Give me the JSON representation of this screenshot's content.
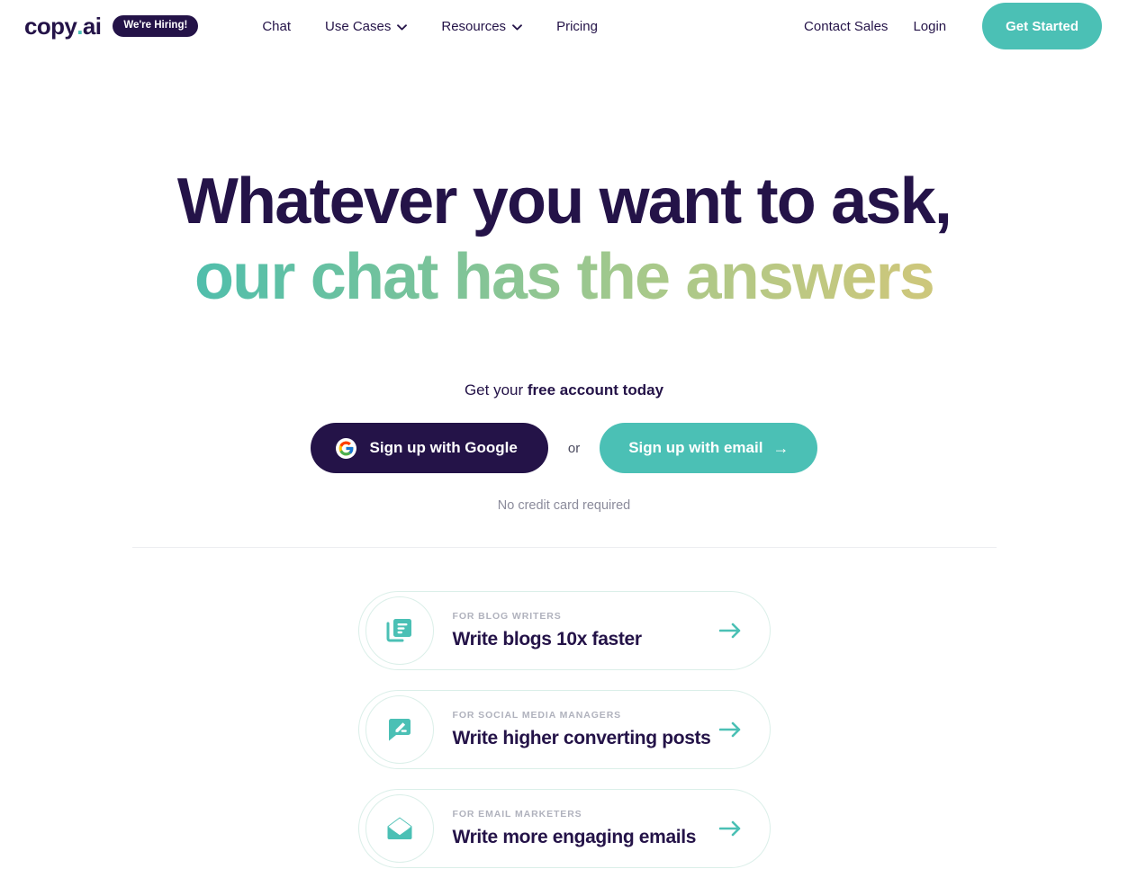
{
  "brand": {
    "logo_text_1": "copy",
    "logo_dot": ".",
    "logo_text_2": "ai",
    "hiring_badge": "We're Hiring!",
    "accent_teal": "#4BC0B5",
    "dark_navy": "#241348",
    "gradient_start": "#3FBDB6",
    "gradient_end": "#D7C774"
  },
  "nav": {
    "items": [
      {
        "label": "Chat",
        "has_dropdown": false
      },
      {
        "label": "Use Cases",
        "has_dropdown": true
      },
      {
        "label": "Resources",
        "has_dropdown": true
      },
      {
        "label": "Pricing",
        "has_dropdown": false
      }
    ],
    "contact_sales": "Contact Sales",
    "login": "Login",
    "get_started": "Get Started"
  },
  "hero": {
    "title_line_1": "Whatever you want to ask,",
    "title_line_2": "our chat has the answers",
    "subtitle_prefix": "Get your ",
    "subtitle_strong": "free account today",
    "google_button": "Sign up with Google",
    "or": "or",
    "email_button": "Sign up with email",
    "email_button_arrow": "→",
    "no_credit_card": "No credit card required"
  },
  "cards": [
    {
      "icon": "documents-stack-icon",
      "eyebrow": "FOR BLOG WRITERS",
      "title": "Write blogs 10x faster",
      "arrow": "arrow-right-icon"
    },
    {
      "icon": "chat-pencil-icon",
      "eyebrow": "FOR SOCIAL MEDIA MANAGERS",
      "title": "Write higher converting posts",
      "arrow": "arrow-right-icon"
    },
    {
      "icon": "open-envelope-icon",
      "eyebrow": "FOR EMAIL MARKETERS",
      "title": "Write more engaging emails",
      "arrow": "arrow-right-icon"
    }
  ]
}
